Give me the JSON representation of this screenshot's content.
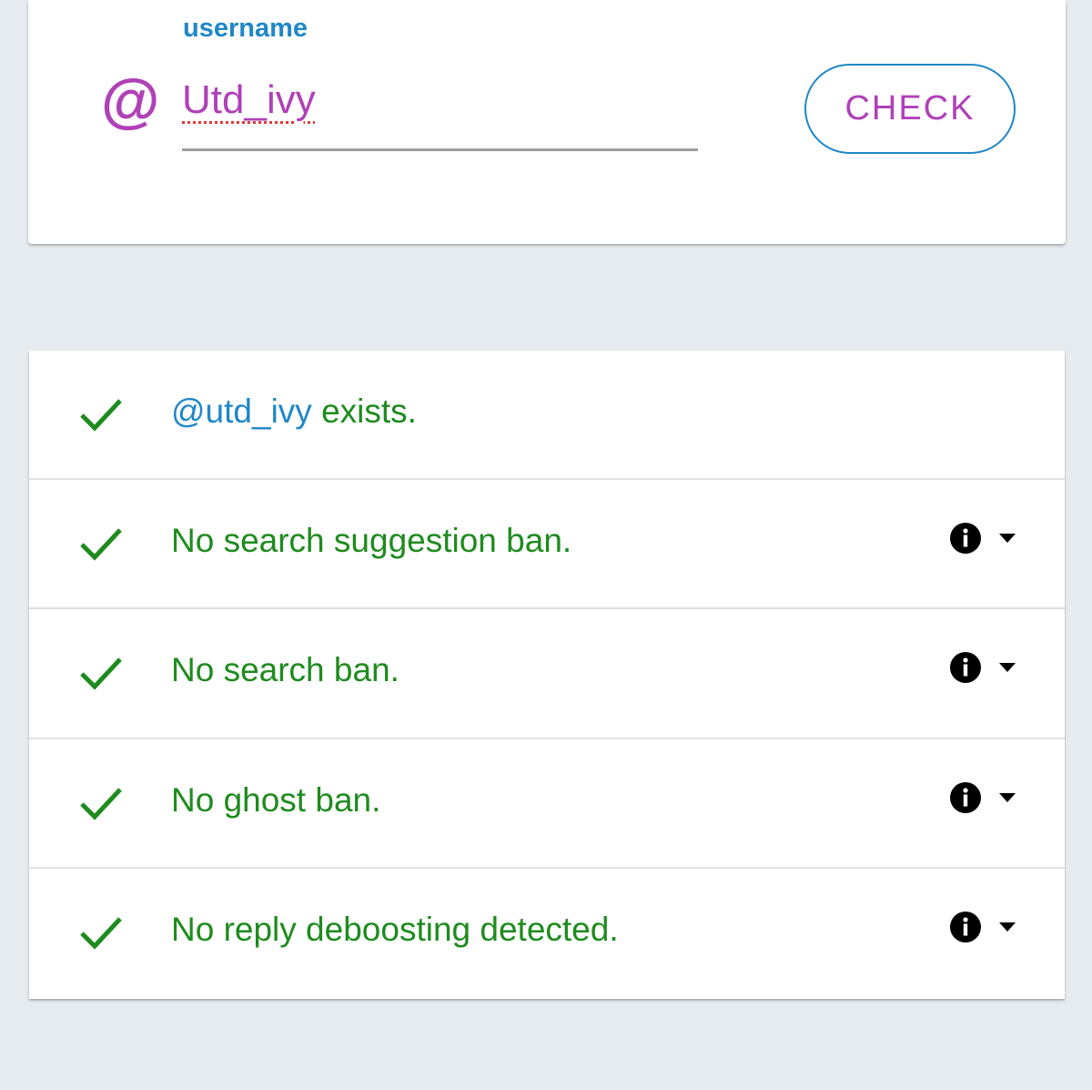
{
  "search": {
    "label": "username",
    "at_symbol": "@",
    "username_value": "Utd_ivy",
    "check_button": "CHECK"
  },
  "results": [
    {
      "mention": "@utd_ivy",
      "text": " exists.",
      "status": "pass",
      "has_info": false
    },
    {
      "text": "No search suggestion ban.",
      "status": "pass",
      "has_info": true
    },
    {
      "text": "No search ban.",
      "status": "pass",
      "has_info": true
    },
    {
      "text": "No ghost ban.",
      "status": "pass",
      "has_info": true
    },
    {
      "text": "No reply deboosting detected.",
      "status": "pass",
      "has_info": true
    }
  ],
  "icons": {
    "status": "check-icon",
    "info": "info-icon",
    "expand": "arrow-drop-down-icon"
  },
  "colors": {
    "accent_blue": "#1f87c8",
    "accent_purple": "#b040b8",
    "success_green": "#1e8b1e",
    "background": "#e6ebef"
  }
}
